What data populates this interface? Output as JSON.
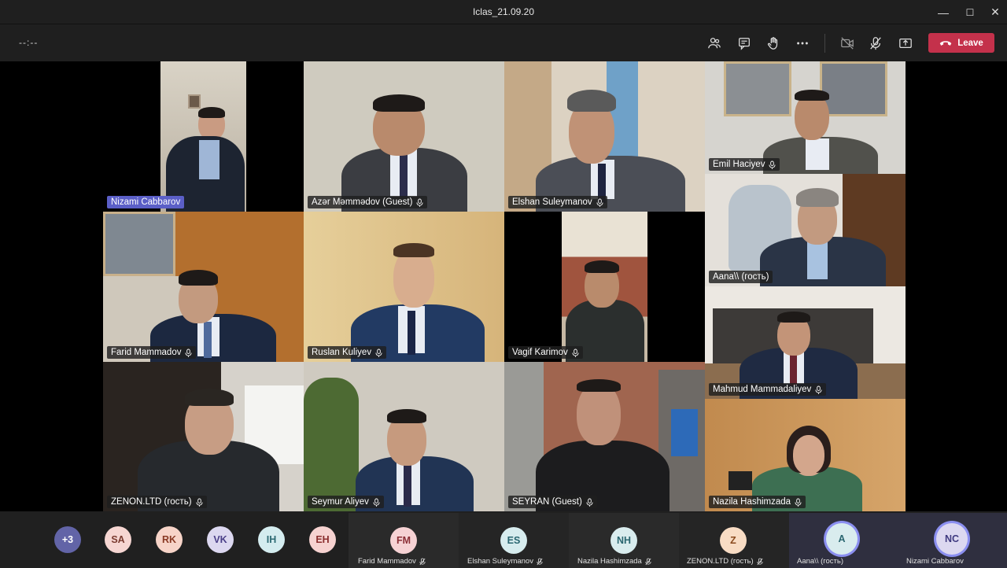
{
  "window": {
    "title": "Iclas_21.09.20",
    "minimize": "—",
    "maximize": "☐",
    "close": "✕"
  },
  "toolbar": {
    "timer": "--:--",
    "leave_label": "Leave",
    "icons": [
      "participants-icon",
      "chat-icon",
      "raise-hand-icon",
      "more-icon",
      "camera-off-icon",
      "mic-off-icon",
      "share-screen-icon"
    ]
  },
  "tiles": [
    {
      "name": "Nizami Cabbarov",
      "active": true
    },
    {
      "name": "Azər Məmmədov (Guest)"
    },
    {
      "name": "Elshan Suleymanov"
    },
    {
      "name": "Emil Haciyev"
    },
    {
      "name": "Aana\\\\ (гость)"
    },
    {
      "name": "Farid Mammadov"
    },
    {
      "name": "Ruslan Kuliyev"
    },
    {
      "name": "Vagif Karimov"
    },
    {
      "name": "Mahmud Mammadaliyev"
    },
    {
      "name": "ZENON.LTD (гость)"
    },
    {
      "name": "Seymur Aliyev"
    },
    {
      "name": "SEYRAN (Guest)"
    },
    {
      "name": "Nazila Hashimzada"
    }
  ],
  "bottom": {
    "overflow": "+3",
    "avatars": [
      {
        "initials": "SA",
        "bg": "#f6d6d2",
        "fg": "#7a3b30"
      },
      {
        "initials": "RK",
        "bg": "#f7d4c8",
        "fg": "#8a3a24"
      },
      {
        "initials": "VK",
        "bg": "#dcd8f0",
        "fg": "#4a3f88"
      },
      {
        "initials": "IH",
        "bg": "#d4ecef",
        "fg": "#2d6a73"
      },
      {
        "initials": "EH",
        "bg": "#f6d2d0",
        "fg": "#8a2e2e"
      }
    ],
    "panels": [
      {
        "initials": "FM",
        "label": "Farid Mammadov",
        "bg": "#f6d2d4",
        "fg": "#8a2e35"
      },
      {
        "initials": "ES",
        "label": "Elshan Suleymanov",
        "bg": "#d7ecee",
        "fg": "#2a6670"
      },
      {
        "initials": "NH",
        "label": "Nazila Hashimzada",
        "bg": "#d9ecee",
        "fg": "#2a6670"
      },
      {
        "initials": "Z",
        "label": "ZENON.LTD (гость)",
        "bg": "#f8dcc4",
        "fg": "#8a4a1e"
      },
      {
        "initials": "A",
        "label": "Aana\\\\ (гость)",
        "bg": "#d9ecee",
        "fg": "#2a6670"
      },
      {
        "initials": "NC",
        "label": "Nizami Cabbarov",
        "bg": "#dcd8f0",
        "fg": "#3f3a80"
      }
    ],
    "overflow_bg": "#6264a7"
  }
}
